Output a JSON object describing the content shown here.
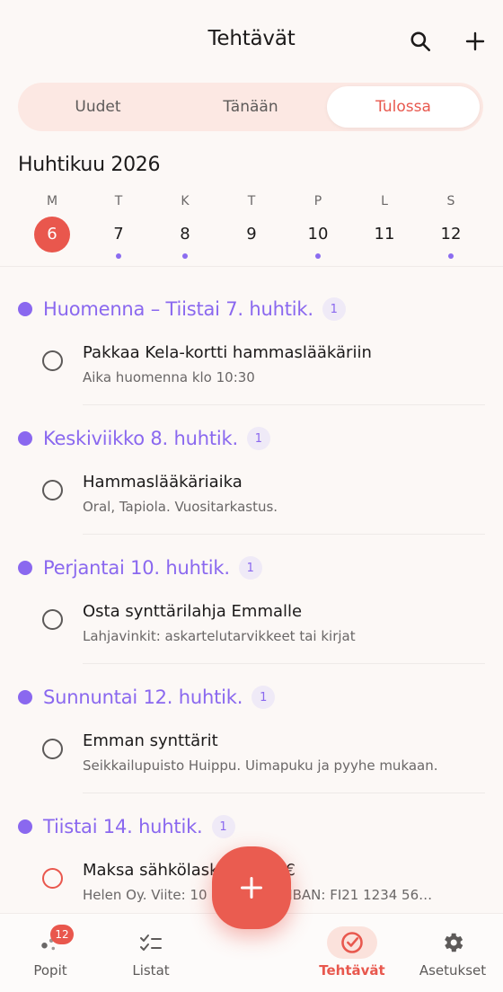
{
  "header": {
    "title": "Tehtävät",
    "search_icon": "search-icon",
    "add_icon": "plus-icon"
  },
  "tabs": [
    {
      "label": "Uudet",
      "active": false
    },
    {
      "label": "Tänään",
      "active": false
    },
    {
      "label": "Tulossa",
      "active": true
    }
  ],
  "calendar": {
    "month_label": "Huhtikuu 2026",
    "days": [
      {
        "letter": "M",
        "num": "6",
        "today": true,
        "dot": false
      },
      {
        "letter": "T",
        "num": "7",
        "today": false,
        "dot": true
      },
      {
        "letter": "K",
        "num": "8",
        "today": false,
        "dot": true
      },
      {
        "letter": "T",
        "num": "9",
        "today": false,
        "dot": false
      },
      {
        "letter": "P",
        "num": "10",
        "today": false,
        "dot": true
      },
      {
        "letter": "L",
        "num": "11",
        "today": false,
        "dot": false
      },
      {
        "letter": "S",
        "num": "12",
        "today": false,
        "dot": true
      }
    ]
  },
  "groups": [
    {
      "title": "Huomenna – Tiistai 7. huhtik.",
      "count": "1",
      "task": {
        "title": "Pakkaa Kela-kortti hammaslääkäriin",
        "subtitle": "Aika huomenna klo 10:30",
        "urgent": false
      }
    },
    {
      "title": "Keskiviikko 8. huhtik.",
      "count": "1",
      "task": {
        "title": "Hammaslääkäriaika",
        "subtitle": "Oral, Tapiola. Vuositarkastus.",
        "urgent": false
      }
    },
    {
      "title": "Perjantai 10. huhtik.",
      "count": "1",
      "task": {
        "title": "Osta synttärilahja Emmalle",
        "subtitle": "Lahjavinkit: askartelutarvikkeet tai kirjat",
        "urgent": false
      }
    },
    {
      "title": "Sunnuntai 12. huhtik.",
      "count": "1",
      "task": {
        "title": "Emman synttärit",
        "subtitle": "Seikkailupuisto Huippu. Uimapuku ja pyyhe mukaan.",
        "urgent": false
      }
    },
    {
      "title": "Tiistai 14. huhtik.",
      "count": "1",
      "task": {
        "title": "Maksa sähkölasku 74,20 €",
        "subtitle": "Helen Oy. Viite: 10 450 200 3. IBAN: FI21 1234 56…",
        "urgent": true
      }
    }
  ],
  "fab": {
    "icon": "plus-icon"
  },
  "tabbar": [
    {
      "label": "Popit",
      "icon": "dots-icon",
      "badge": "12",
      "active": false
    },
    {
      "label": "Listat",
      "icon": "checklist-icon",
      "active": false
    },
    {
      "label": "Tehtävät",
      "icon": "check-circle-icon",
      "active": true
    },
    {
      "label": "Asetukset",
      "icon": "gear-icon",
      "active": false
    }
  ],
  "colors": {
    "accent": "#e9574d",
    "purple": "#8a68ef",
    "background": "#fcf8f6"
  }
}
